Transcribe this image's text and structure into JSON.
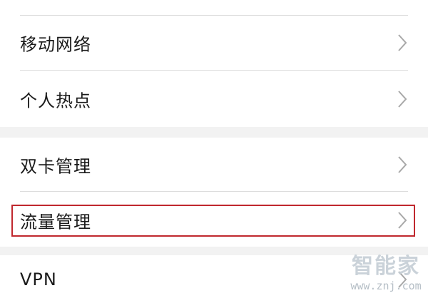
{
  "settings": {
    "items": [
      {
        "label": "移动网络"
      },
      {
        "label": "个人热点"
      },
      {
        "label": "双卡管理"
      },
      {
        "label": "流量管理"
      },
      {
        "label": "VPN"
      }
    ]
  },
  "icons": {
    "chevron": "chevron-right-icon"
  },
  "watermark": {
    "title": "智能家",
    "url": "www.znj.com"
  },
  "colors": {
    "highlight_border": "#c0282e",
    "group_gap": "#f2f2f2",
    "text": "#1a1a1a",
    "chevron": "#a8a8a8"
  }
}
